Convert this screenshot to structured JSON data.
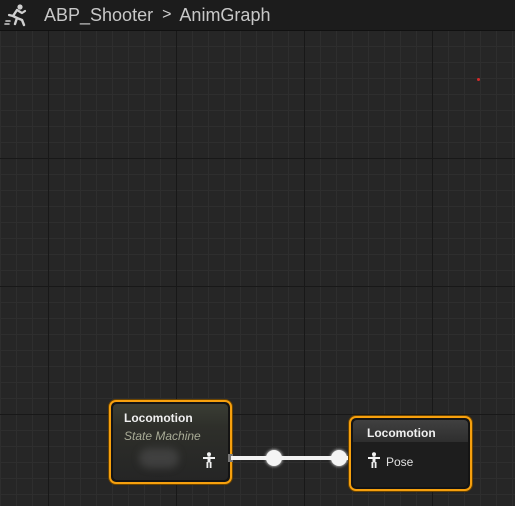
{
  "breadcrumb": {
    "icon": "animation-blueprint-running-man-icon",
    "blueprint": "ABP_Shooter",
    "separator": ">",
    "graph": "AnimGraph"
  },
  "nodes": {
    "state_machine": {
      "title": "Locomotion",
      "subtitle": "State Machine",
      "output_pin_icon": "pose-pin-icon"
    },
    "output_pose": {
      "title": "Locomotion",
      "pin_label": "Pose",
      "input_pin_icon": "pose-pin-icon"
    }
  },
  "colors": {
    "selection_outline": "#f6a00e",
    "graph_background": "#262626",
    "wire": "#f2f2f2",
    "marker_dot": "#d42a2a"
  }
}
